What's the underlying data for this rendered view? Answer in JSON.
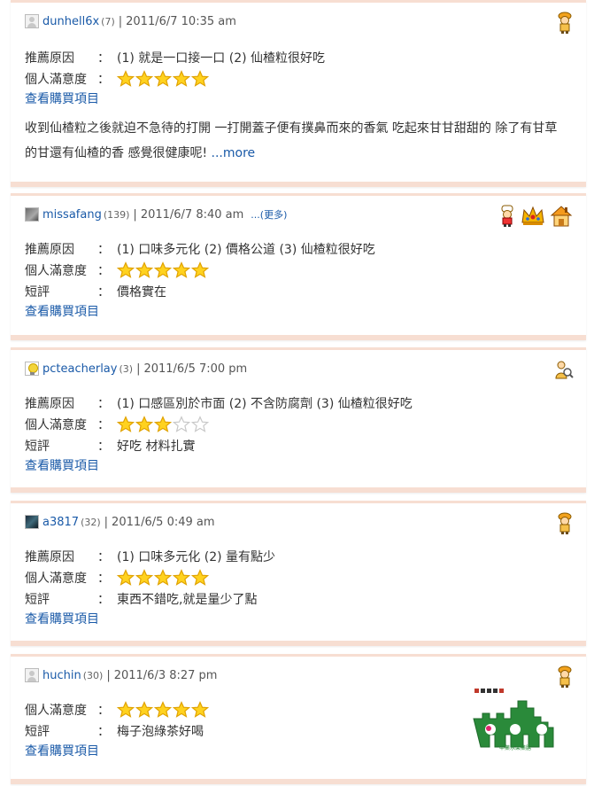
{
  "labels": {
    "reason": "推薦原因",
    "satisfaction": "個人滿意度",
    "short": "短評",
    "colon": "：",
    "view_items": "查看購買項目",
    "more_paren": "...(更多)",
    "more": "...more"
  },
  "reviews": [
    {
      "user": "dunhell6x",
      "count": "(7)",
      "date": "2011/6/7  10:35 am",
      "reasons": "(1) 就是一口接一口   (2) 仙楂粒很好吃",
      "rating": 5,
      "body": "收到仙楂粒之後就迫不急待的打開 一打開蓋子便有撲鼻而來的香氣 吃起來甘甘甜甜的 除了有甘草的甘還有仙楂的香 感覺很健康呢! ",
      "badges": [
        "worker-icon"
      ]
    },
    {
      "user": "missafang",
      "count": "(139)",
      "date": "2011/6/7  8:40 am",
      "reasons": "(1) 口味多元化   (2) 價格公道   (3) 仙楂粒很好吃",
      "rating": 5,
      "short": "價格實在",
      "badges": [
        "chef-icon",
        "crown-icon",
        "house-icon"
      ]
    },
    {
      "user": "pcteacherlay",
      "count": "(3)",
      "date": "2011/6/5  7:00 pm",
      "reasons": "(1) 口感區別於市面   (2) 不含防腐劑   (3) 仙楂粒很好吃",
      "rating": 3,
      "short": "好吃 材料扎實",
      "badges": [
        "search-person-icon"
      ]
    },
    {
      "user": "a3817",
      "count": "(32)",
      "date": "2011/6/5  0:49 am",
      "reasons": "(1) 口味多元化   (2) 量有點少",
      "rating": 5,
      "short": "東西不錯吃,就是量少了點",
      "badges": [
        "worker-icon"
      ]
    },
    {
      "user": "huchin",
      "count": "(30)",
      "date": "2011/6/3  8:27 pm",
      "rating": 5,
      "short": "梅子泡綠茶好喝",
      "badges": [
        "worker-icon"
      ],
      "logo_caption": "中藥水果藥膳"
    }
  ],
  "colors": {
    "link": "#1a5aa8",
    "border": "#f7ded2",
    "star_fill": "#ffd21f",
    "star_stroke": "#e0a200",
    "logo_green": "#2a8a3a"
  }
}
